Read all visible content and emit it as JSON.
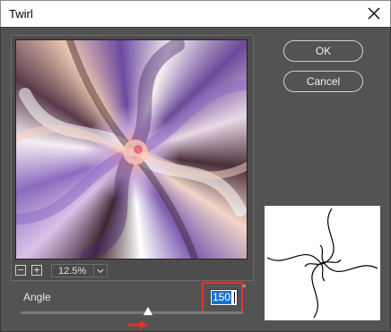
{
  "window": {
    "title": "Twirl"
  },
  "zoom": {
    "out_label": "−",
    "in_label": "+",
    "value": "12.5%"
  },
  "buttons": {
    "ok": "OK",
    "cancel": "Cancel"
  },
  "angle": {
    "label": "Angle",
    "value": "150",
    "unit": "°",
    "min": -999,
    "max": 999,
    "slider_fraction": 0.58
  },
  "colors": {
    "dialog_bg": "#535353",
    "highlight_box": "#e5332a",
    "selection": "#1a73c8",
    "arrow": "#e5332a"
  },
  "icons": {
    "close": "close-icon",
    "zoom_out": "minus-icon",
    "zoom_in": "plus-icon",
    "zoom_menu": "chevron-down-icon",
    "slider": "triangle-slider-icon",
    "annotation": "arrow-right-icon"
  }
}
